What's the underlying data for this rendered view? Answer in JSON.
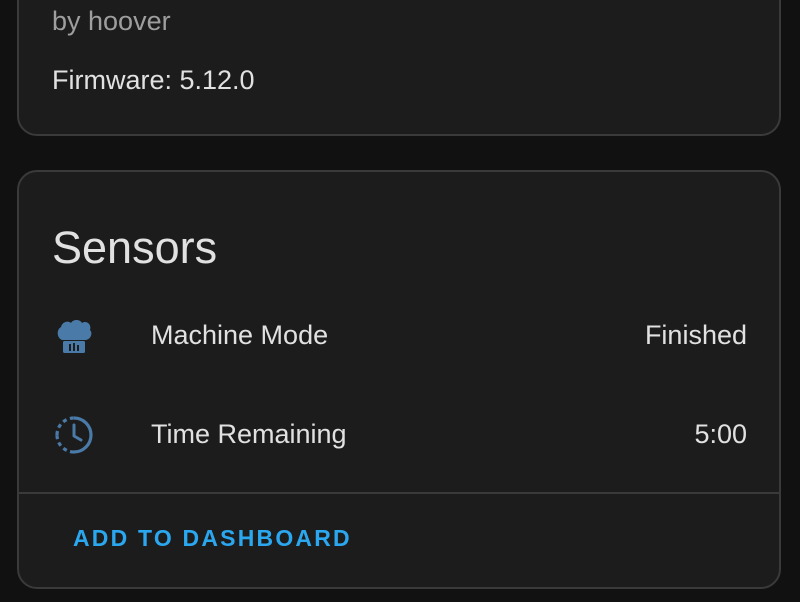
{
  "device": {
    "by_line": "by hoover",
    "firmware": "Firmware: 5.12.0"
  },
  "sensors": {
    "title": "Sensors",
    "items": [
      {
        "icon": "chef-hat-icon",
        "name": "Machine Mode",
        "value": "Finished"
      },
      {
        "icon": "timer-clock-icon",
        "name": "Time Remaining",
        "value": "5:00"
      }
    ],
    "action_label": "ADD TO DASHBOARD"
  },
  "colors": {
    "background": "#111111",
    "card": "#1c1c1c",
    "border": "#3a3a3a",
    "icon": "#4a7aa8",
    "accent": "#2ba7f0"
  }
}
